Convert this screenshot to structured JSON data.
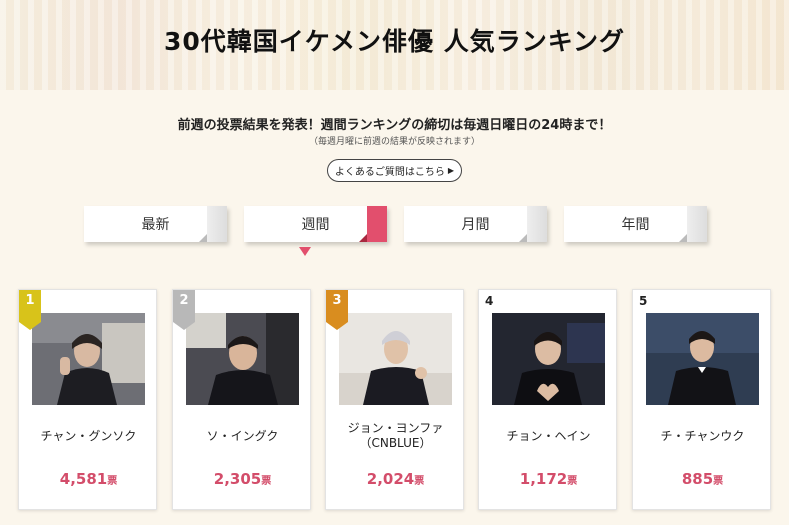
{
  "title": "30代韓国イケメン俳優 人気ランキング",
  "announcement": "前週の投票結果を発表！週間ランキングの締切は毎週日曜日の24時まで！",
  "announcement_note": "（毎週月曜に前週の結果が反映されます）",
  "faq_button": "よくあるご質問はこちら",
  "tabs": [
    {
      "label": "最新",
      "active": false
    },
    {
      "label": "週間",
      "active": true
    },
    {
      "label": "月間",
      "active": false
    },
    {
      "label": "年間",
      "active": false
    }
  ],
  "vote_unit": "票",
  "ranking": [
    {
      "rank": "1",
      "name": "チャン・グンソク",
      "name2": "",
      "votes": "4,581",
      "badge": "gold"
    },
    {
      "rank": "2",
      "name": "ソ・イングク",
      "name2": "",
      "votes": "2,305",
      "badge": "silver"
    },
    {
      "rank": "3",
      "name": "ジョン・ヨンファ",
      "name2": "（CNBLUE）",
      "votes": "2,024",
      "badge": "bronze"
    },
    {
      "rank": "4",
      "name": "チョン・ヘイン",
      "name2": "",
      "votes": "1,172",
      "badge": "none"
    },
    {
      "rank": "5",
      "name": "チ・チャンウク",
      "name2": "",
      "votes": "885",
      "badge": "none"
    }
  ],
  "colors": {
    "accent": "#e24f6d",
    "votes": "#d34d6a",
    "gold": "#d8c31a",
    "silver": "#b8b8b8",
    "bronze": "#d98d1f"
  }
}
